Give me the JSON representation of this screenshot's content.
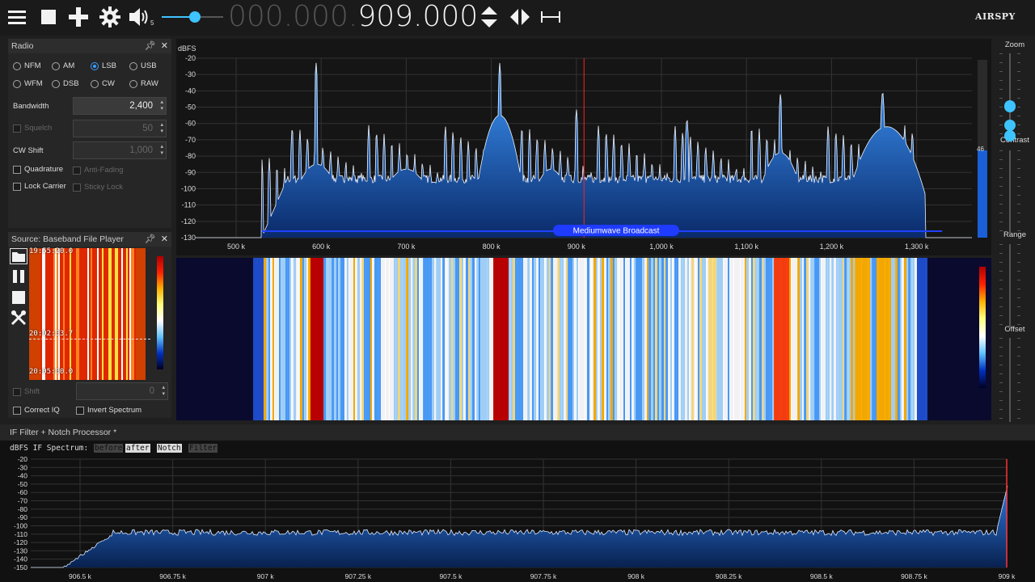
{
  "toolbar": {
    "menu_icon": "hamburger-icon",
    "stop_icon": "stop-icon",
    "add_icon": "plus-icon",
    "settings_icon": "gear-icon",
    "volume_icon": "speaker-icon",
    "volume_level": "5",
    "volume_fraction": 0.55,
    "freq_dim": "000.000.",
    "freq_lit": "909.000",
    "brand": "AIRSPY"
  },
  "radio": {
    "title": "Radio",
    "modes": [
      "NFM",
      "AM",
      "LSB",
      "USB",
      "WFM",
      "DSB",
      "CW",
      "RAW"
    ],
    "selected_mode": "LSB",
    "bandwidth_label": "Bandwidth",
    "bandwidth_value": "2,400",
    "squelch_label": "Squelch",
    "squelch_value": "50",
    "cwshift_label": "CW Shift",
    "cwshift_value": "1,000",
    "quadrature_label": "Quadrature",
    "antifading_label": "Anti-Fading",
    "lockcarrier_label": "Lock Carrier",
    "stickylock_label": "Sticky Lock"
  },
  "source": {
    "title": "Source: Baseband File Player",
    "time_top": "19:55:20.0",
    "time_mid": "20:02:03.7",
    "time_bot": "20:05:00.0",
    "shift_label": "Shift",
    "shift_value": "0",
    "correctiq_label": "Correct IQ",
    "invert_label": "Invert Spectrum"
  },
  "spectrum": {
    "unit": "dBFS",
    "y_ticks": [
      "-20",
      "-30",
      "-40",
      "-50",
      "-60",
      "-70",
      "-80",
      "-90",
      "-100",
      "-110",
      "-120",
      "-130"
    ],
    "x_ticks": [
      "500 k",
      "600 k",
      "700 k",
      "800 k",
      "900 k",
      "1,000 k",
      "1,100 k",
      "1,200 k",
      "1,300 k"
    ],
    "band_label": "Mediumwave Broadcast",
    "signal_level": "46",
    "colors": {
      "fill": "#1a6fd1",
      "trace": "#ffffff",
      "marker": "#ff2020",
      "band": "#2040ff"
    }
  },
  "side": {
    "zoom_label": "Zoom",
    "contrast_label": "Contrast",
    "range_label": "Range",
    "offset_label": "Offset"
  },
  "ifpanel": {
    "title": "IF Filter + Notch Processor *",
    "caption": "dBFS IF Spectrum:",
    "buttons": [
      "before",
      "after",
      "Notch",
      "Filter"
    ],
    "y_ticks": [
      "-20",
      "-30",
      "-40",
      "-50",
      "-60",
      "-70",
      "-80",
      "-90",
      "-100",
      "-110",
      "-120",
      "-130",
      "-140",
      "-150"
    ],
    "x_ticks": [
      "906.5 k",
      "906.75 k",
      "907 k",
      "907.25 k",
      "907.5 k",
      "907.75 k",
      "908 k",
      "908.25 k",
      "908.5 k",
      "908.75 k",
      "909 k"
    ]
  }
}
